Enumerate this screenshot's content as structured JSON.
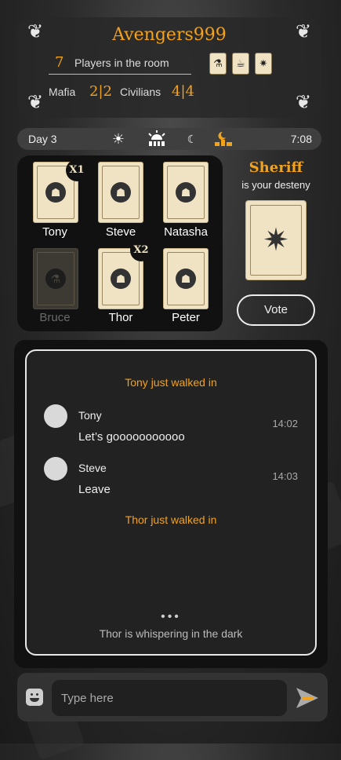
{
  "room": {
    "name": "Avengers999",
    "players_count": "7",
    "players_label": "Players in the room",
    "mafia_label": "Mafia",
    "mafia_count": "2|2",
    "civilians_label": "Civilians",
    "civilians_count": "4|4"
  },
  "role_icons": [
    "doctor-icon",
    "mug-icon",
    "sheriff-star-icon"
  ],
  "day_bar": {
    "day_label": "Day 3",
    "time": "7:08",
    "phases": [
      "sun-icon",
      "sunset-icon",
      "moon-icon",
      "night-city-icon"
    ],
    "active_phase": "night-city-icon"
  },
  "players": [
    {
      "name": "Tony",
      "badge": "X1",
      "alive": true
    },
    {
      "name": "Steve",
      "badge": "",
      "alive": true
    },
    {
      "name": "Natasha",
      "badge": "",
      "alive": true
    },
    {
      "name": "Bruce",
      "badge": "",
      "alive": false
    },
    {
      "name": "Thor",
      "badge": "X2",
      "alive": true
    },
    {
      "name": "Peter",
      "badge": "",
      "alive": true
    }
  ],
  "my_role": {
    "title": "Sheriff",
    "subtitle": "is your desteny",
    "vote_label": "Vote"
  },
  "chat": {
    "system_1": "Tony just walked in",
    "messages": [
      {
        "name": "Tony",
        "text": "Let’s gooooooooooo",
        "time": "14:02"
      },
      {
        "name": "Steve",
        "text": "Leave",
        "time": "14:03"
      }
    ],
    "system_2": "Thor just walked in",
    "typing_dots": "•••",
    "typing_text": "Thor is whispering in the dark"
  },
  "composer": {
    "placeholder": "Type here"
  },
  "colors": {
    "accent": "#f3a21b",
    "card": "#f0e3c3",
    "panel": "#111111"
  }
}
